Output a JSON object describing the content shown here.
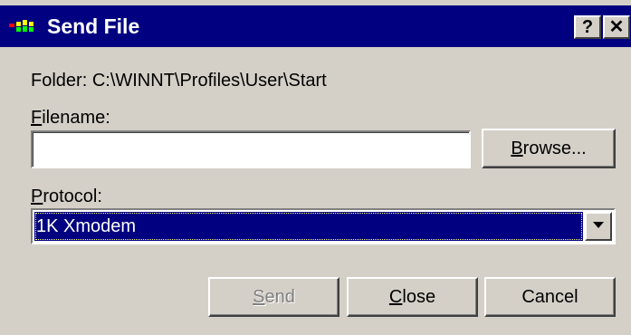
{
  "window": {
    "title": "Send File",
    "app_icon": "send-file-app-icon",
    "help_glyph": "?",
    "close_glyph": "✕"
  },
  "folder": {
    "label": "Folder:",
    "path": "C:\\WINNT\\Profiles\\User\\Start"
  },
  "filename": {
    "label_accel": "F",
    "label_rest": "ilename:",
    "value": ""
  },
  "browse": {
    "label_accel": "B",
    "label_rest": "rowse..."
  },
  "protocol": {
    "label_accel": "P",
    "label_rest": "rotocol:",
    "selected": "1K Xmodem"
  },
  "buttons": {
    "send_accel": "S",
    "send_rest": "end",
    "close_accel": "C",
    "close_rest": "lose",
    "cancel": "Cancel"
  },
  "colors": {
    "titlebar": "#000080",
    "face": "#d4d0c8",
    "selection": "#000080"
  }
}
